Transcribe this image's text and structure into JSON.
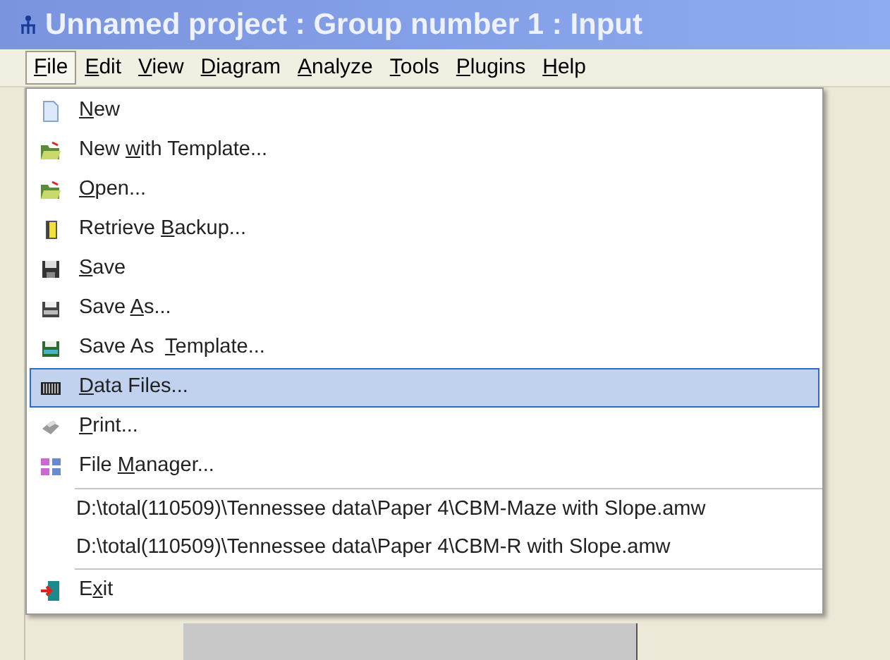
{
  "window": {
    "title": "Unnamed project : Group number 1 : Input"
  },
  "menu_bar": [
    {
      "key": "F",
      "post": "ile",
      "selected": true
    },
    {
      "key": "E",
      "post": "dit",
      "selected": false
    },
    {
      "key": "V",
      "post": "iew",
      "selected": false
    },
    {
      "key": "D",
      "post": "iagram",
      "selected": false
    },
    {
      "key": "A",
      "post": "nalyze",
      "selected": false
    },
    {
      "key": "T",
      "post": "ools",
      "selected": false
    },
    {
      "key": "P",
      "post": "lugins",
      "selected": false
    },
    {
      "key": "H",
      "post": "elp",
      "selected": false
    }
  ],
  "file_menu": [
    {
      "kind": "command",
      "key": "N",
      "post": "ew",
      "selected": false
    },
    {
      "kind": "command",
      "pre": "New ",
      "key": "w",
      "post": "ith Template...",
      "selected": false
    },
    {
      "kind": "command",
      "key": "O",
      "post": "pen...",
      "selected": false
    },
    {
      "kind": "command",
      "pre": "Retrieve ",
      "key": "B",
      "post": "ackup...",
      "selected": false
    },
    {
      "kind": "command",
      "key": "S",
      "post": "ave",
      "selected": false
    },
    {
      "kind": "command",
      "pre": "Save ",
      "key": "A",
      "post": "s...",
      "selected": false
    },
    {
      "kind": "command",
      "pre": "Save As  ",
      "key": "T",
      "post": "emplate...",
      "selected": false
    },
    {
      "kind": "command",
      "key": "D",
      "post": "ata Files...",
      "selected": true
    },
    {
      "kind": "command",
      "key": "P",
      "post": "rint...",
      "selected": false
    },
    {
      "kind": "command",
      "pre": "File ",
      "key": "M",
      "post": "anager...",
      "selected": false
    },
    {
      "kind": "separator"
    },
    {
      "kind": "recent",
      "text": "D:\\total(110509)\\Tennessee data\\Paper 4\\CBM-Maze with Slope.amw",
      "selected": false
    },
    {
      "kind": "recent",
      "text": "D:\\total(110509)\\Tennessee data\\Paper 4\\CBM-R with Slope.amw",
      "selected": false
    },
    {
      "kind": "separator"
    },
    {
      "kind": "command",
      "pre": "E",
      "key": "x",
      "post": "it",
      "selected": false
    }
  ]
}
